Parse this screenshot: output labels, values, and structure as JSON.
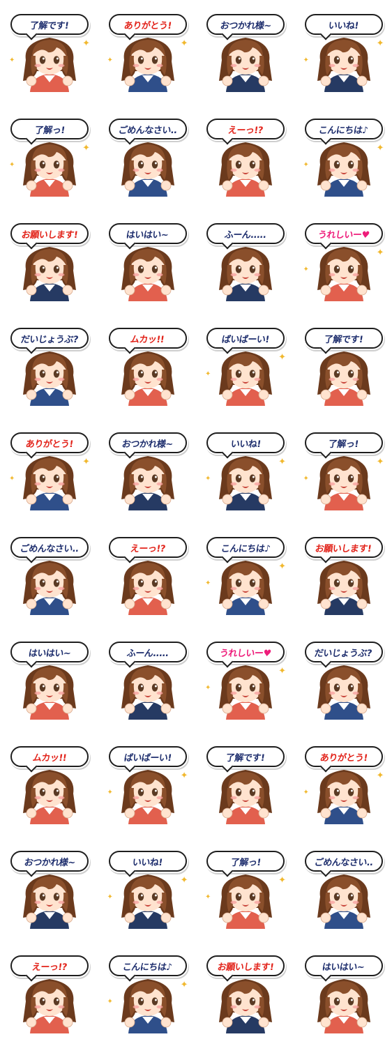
{
  "colors": {
    "dark_text": "#1f2f6e",
    "red_text": "#e2231a",
    "pink_text": "#ee1c7a",
    "hair": "#8a4f2b",
    "hair_shadow": "#6b3a1d",
    "skin": "#ffe3cf",
    "blush": "#f7a3a0",
    "eyes": "#5a3a24",
    "shirt_red": "#e2604e",
    "shirt_blue": "#2f4f8a",
    "shirt_navy": "#263a63",
    "sparkle": "#f1b82e"
  },
  "stickers": [
    {
      "text": "了解です!",
      "tone": "dark",
      "shirt": "red",
      "sparkle": "star-icon"
    },
    {
      "text": "ありがとう!",
      "tone": "red",
      "shirt": "blue",
      "sparkle": "star-icon"
    },
    {
      "text": "おつかれ様~",
      "tone": "dark",
      "shirt": "navy",
      "sparkle": ""
    },
    {
      "text": "いいね!",
      "tone": "dark",
      "shirt": "navy",
      "sparkle": "star-icon"
    },
    {
      "text": "了解っ!",
      "tone": "dark",
      "shirt": "red",
      "sparkle": "star-icon"
    },
    {
      "text": "ごめんなさい..",
      "tone": "dark",
      "shirt": "blue",
      "sparkle": ""
    },
    {
      "text": "えーっ!?",
      "tone": "red",
      "shirt": "red",
      "sparkle": ""
    },
    {
      "text": "こんにちは♪",
      "tone": "dark",
      "shirt": "blue",
      "sparkle": "star-icon"
    },
    {
      "text": "お願いします!",
      "tone": "red",
      "shirt": "navy",
      "sparkle": ""
    },
    {
      "text": "はいはい~",
      "tone": "dark",
      "shirt": "red",
      "sparkle": ""
    },
    {
      "text": "ふーん.....",
      "tone": "dark",
      "shirt": "navy",
      "sparkle": ""
    },
    {
      "text": "うれしいー♥",
      "tone": "pink",
      "shirt": "red",
      "sparkle": "star-icon"
    },
    {
      "text": "だいじょうぶ?",
      "tone": "dark",
      "shirt": "blue",
      "sparkle": ""
    },
    {
      "text": "ムカッ!!",
      "tone": "red",
      "shirt": "red",
      "sparkle": ""
    },
    {
      "text": "ばいばーい!",
      "tone": "dark",
      "shirt": "red",
      "sparkle": "star-icon"
    },
    {
      "text": "了解です!",
      "tone": "dark",
      "shirt": "red",
      "sparkle": ""
    },
    {
      "text": "ありがとう!",
      "tone": "red",
      "shirt": "blue",
      "sparkle": "star-icon"
    },
    {
      "text": "おつかれ様~",
      "tone": "dark",
      "shirt": "navy",
      "sparkle": ""
    },
    {
      "text": "いいね!",
      "tone": "dark",
      "shirt": "navy",
      "sparkle": "star-icon"
    },
    {
      "text": "了解っ!",
      "tone": "dark",
      "shirt": "red",
      "sparkle": "star-icon"
    },
    {
      "text": "ごめんなさい..",
      "tone": "dark",
      "shirt": "blue",
      "sparkle": ""
    },
    {
      "text": "えーっ!?",
      "tone": "red",
      "shirt": "red",
      "sparkle": ""
    },
    {
      "text": "こんにちは♪",
      "tone": "dark",
      "shirt": "blue",
      "sparkle": "star-icon"
    },
    {
      "text": "お願いします!",
      "tone": "red",
      "shirt": "navy",
      "sparkle": ""
    },
    {
      "text": "はいはい~",
      "tone": "dark",
      "shirt": "red",
      "sparkle": ""
    },
    {
      "text": "ふーん.....",
      "tone": "dark",
      "shirt": "navy",
      "sparkle": ""
    },
    {
      "text": "うれしいー♥",
      "tone": "pink",
      "shirt": "red",
      "sparkle": "star-icon"
    },
    {
      "text": "だいじょうぶ?",
      "tone": "dark",
      "shirt": "blue",
      "sparkle": ""
    },
    {
      "text": "ムカッ!!",
      "tone": "red",
      "shirt": "red",
      "sparkle": ""
    },
    {
      "text": "ばいばーい!",
      "tone": "dark",
      "shirt": "red",
      "sparkle": "star-icon"
    },
    {
      "text": "了解です!",
      "tone": "dark",
      "shirt": "red",
      "sparkle": ""
    },
    {
      "text": "ありがとう!",
      "tone": "red",
      "shirt": "blue",
      "sparkle": "star-icon"
    },
    {
      "text": "おつかれ様~",
      "tone": "dark",
      "shirt": "navy",
      "sparkle": ""
    },
    {
      "text": "いいね!",
      "tone": "dark",
      "shirt": "navy",
      "sparkle": "star-icon"
    },
    {
      "text": "了解っ!",
      "tone": "dark",
      "shirt": "red",
      "sparkle": "star-icon"
    },
    {
      "text": "ごめんなさい..",
      "tone": "dark",
      "shirt": "blue",
      "sparkle": ""
    },
    {
      "text": "えーっ!?",
      "tone": "red",
      "shirt": "red",
      "sparkle": ""
    },
    {
      "text": "こんにちは♪",
      "tone": "dark",
      "shirt": "blue",
      "sparkle": "star-icon"
    },
    {
      "text": "お願いします!",
      "tone": "red",
      "shirt": "navy",
      "sparkle": ""
    },
    {
      "text": "はいはい~",
      "tone": "dark",
      "shirt": "red",
      "sparkle": ""
    }
  ]
}
